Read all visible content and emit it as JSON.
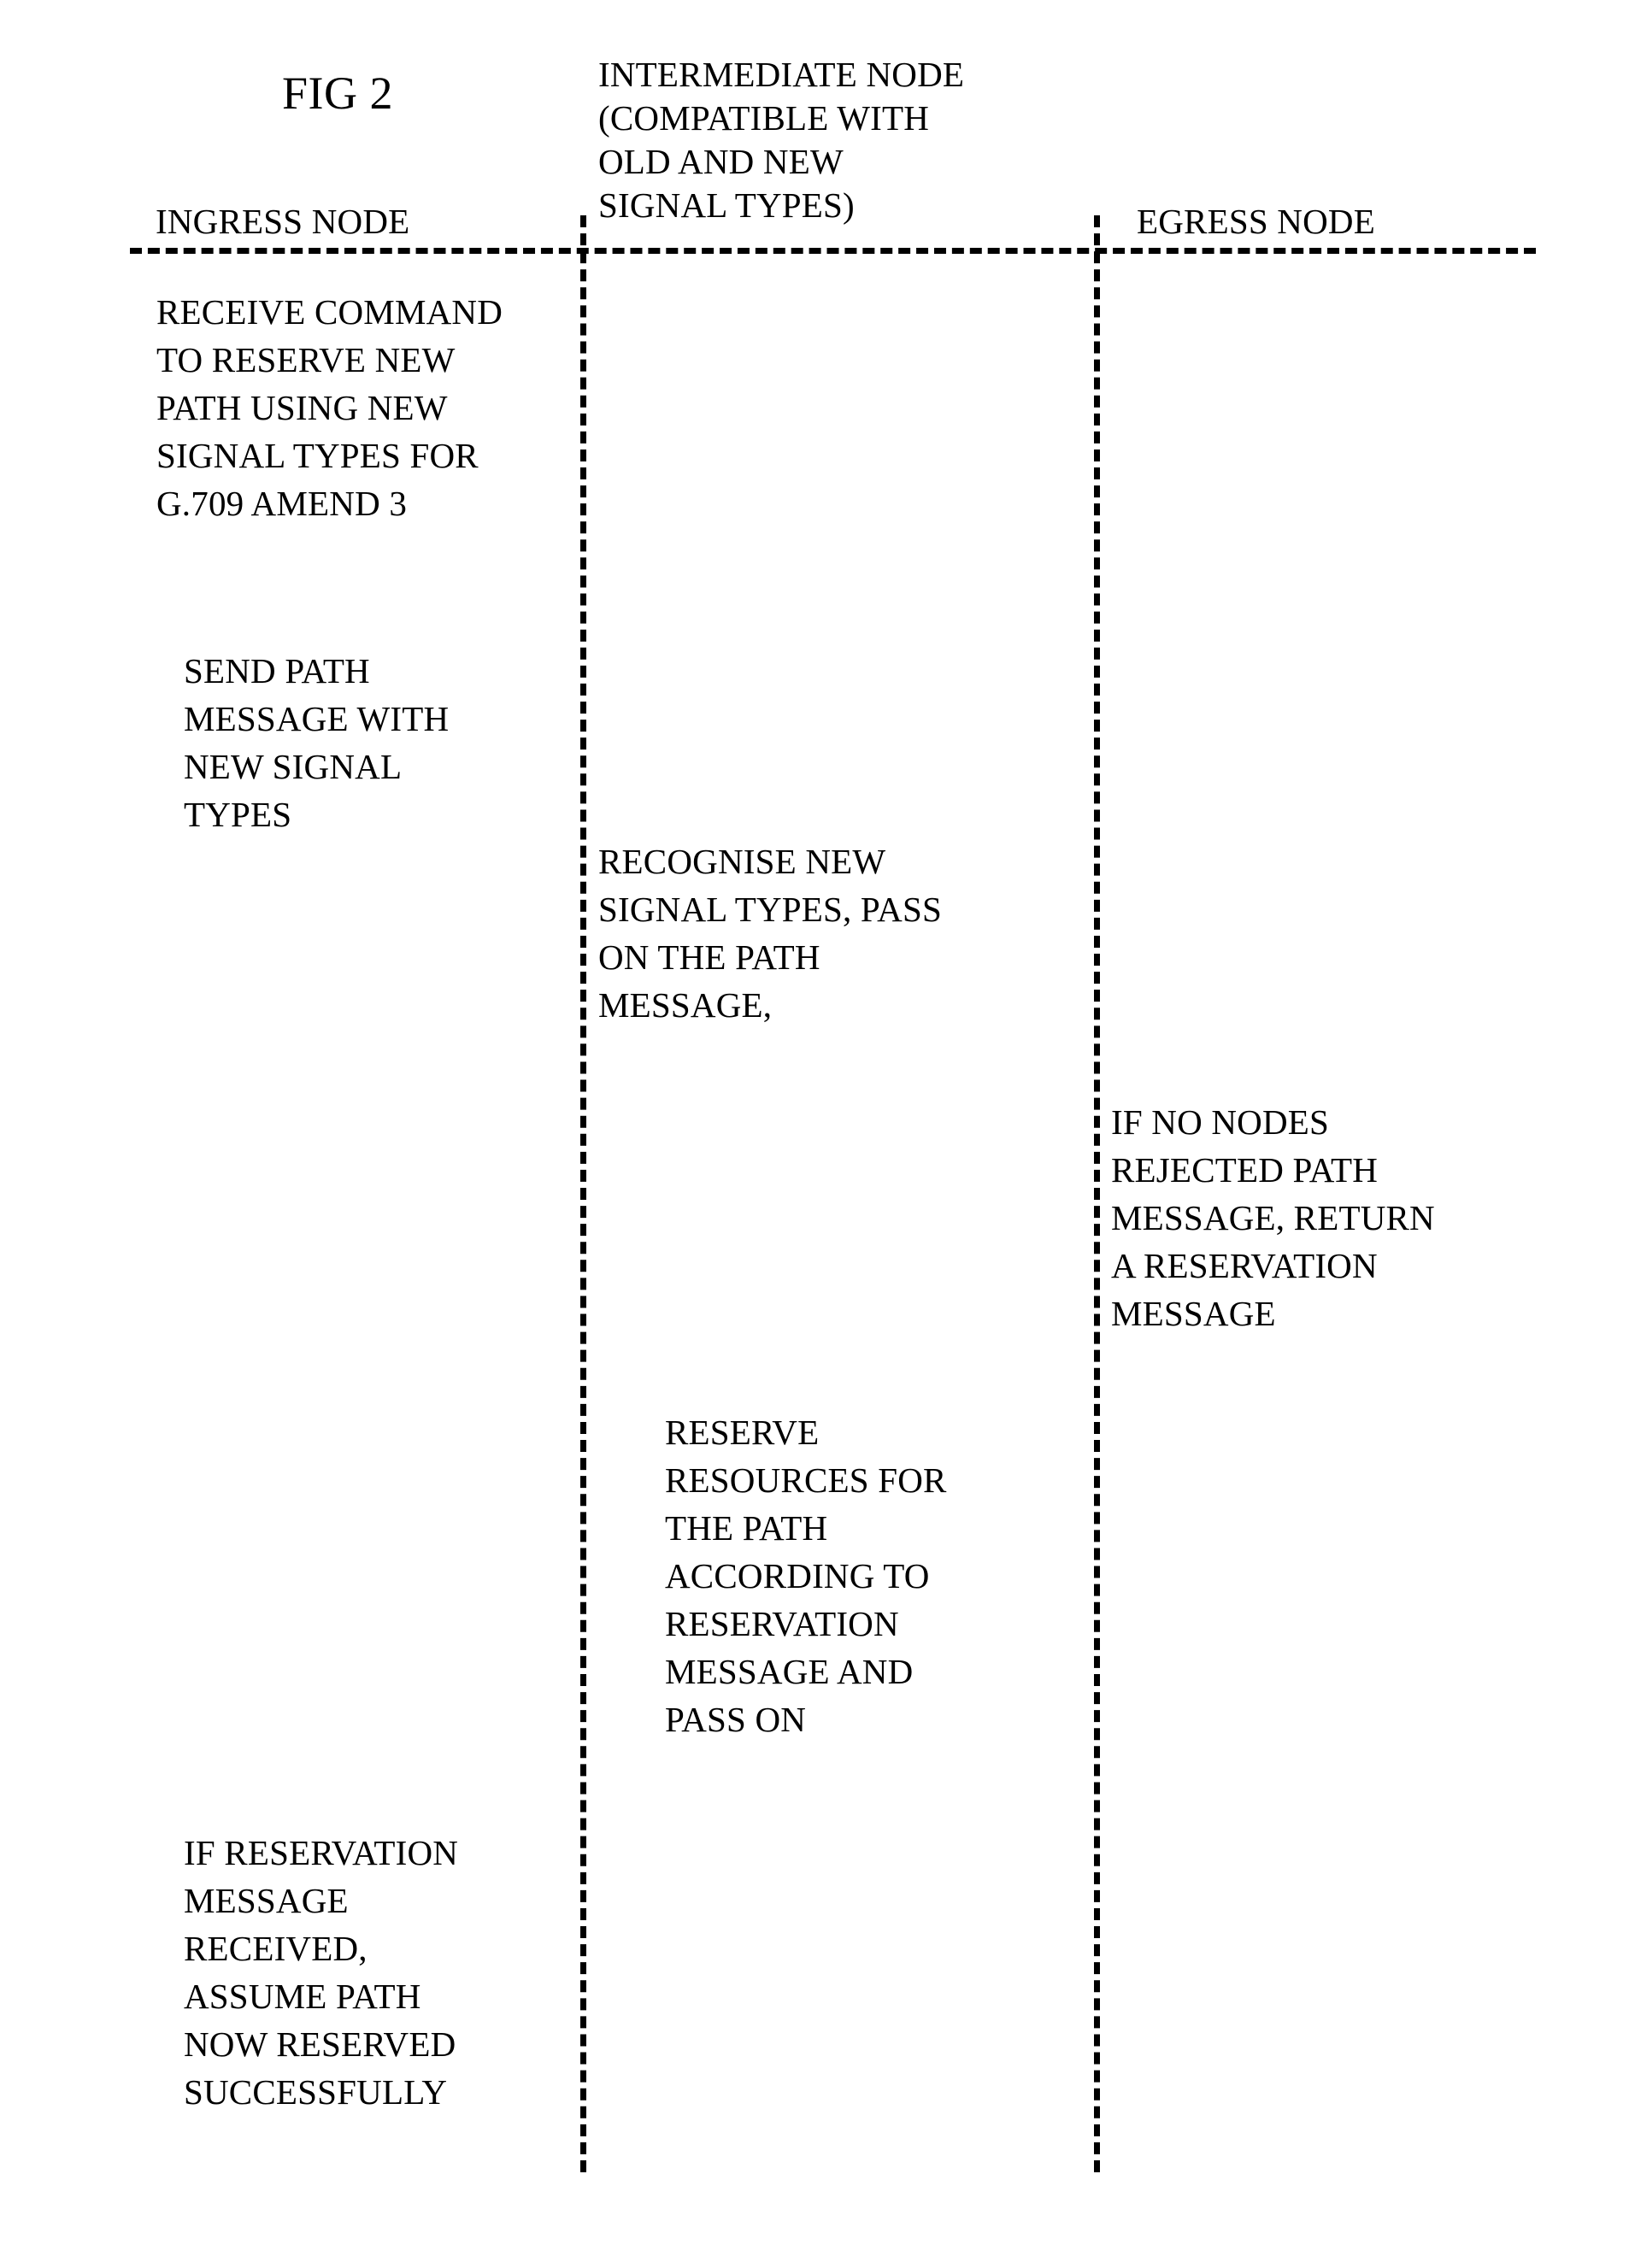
{
  "figure": {
    "title": "FIG 2",
    "type": "patent-sequence-diagram"
  },
  "lanes": [
    {
      "id": "ingress",
      "name": "ingress-node",
      "header_lines": [
        "INGRESS NODE"
      ]
    },
    {
      "id": "intermediate",
      "name": "intermediate-node",
      "header_lines": [
        "INTERMEDIATE NODE",
        "(COMPATIBLE WITH",
        "OLD AND NEW",
        "SIGNAL TYPES)"
      ]
    },
    {
      "id": "egress",
      "name": "egress-node",
      "header_lines": [
        "EGRESS NODE"
      ]
    }
  ],
  "steps": {
    "receive_command": {
      "lane": "ingress",
      "lines": [
        "RECEIVE COMMAND",
        "TO RESERVE NEW",
        "PATH USING NEW",
        "SIGNAL TYPES FOR",
        "G.709 AMEND 3"
      ]
    },
    "send_path_message": {
      "lane": "ingress",
      "lines": [
        "SEND PATH",
        "MESSAGE WITH",
        "NEW SIGNAL",
        "TYPES"
      ]
    },
    "recognise_new_signal_types": {
      "lane": "intermediate",
      "lines": [
        "RECOGNISE NEW",
        "SIGNAL TYPES, PASS",
        "ON THE PATH",
        "MESSAGE,"
      ]
    },
    "if_no_nodes_rejected": {
      "lane": "egress",
      "lines": [
        "IF NO NODES",
        "REJECTED PATH",
        "MESSAGE, RETURN",
        "A RESERVATION",
        "MESSAGE"
      ]
    },
    "reserve_resources": {
      "lane": "intermediate",
      "lines": [
        "RESERVE",
        "RESOURCES FOR",
        "THE PATH",
        "ACCORDING TO",
        "RESERVATION",
        "MESSAGE AND",
        "PASS ON"
      ]
    },
    "if_reservation_received": {
      "lane": "ingress",
      "lines": [
        "IF RESERVATION",
        "MESSAGE",
        "RECEIVED,",
        "ASSUME PATH",
        "NOW RESERVED",
        "SUCCESSFULLY"
      ]
    }
  },
  "colors": {
    "ink": "#000000",
    "paper": "#ffffff"
  }
}
